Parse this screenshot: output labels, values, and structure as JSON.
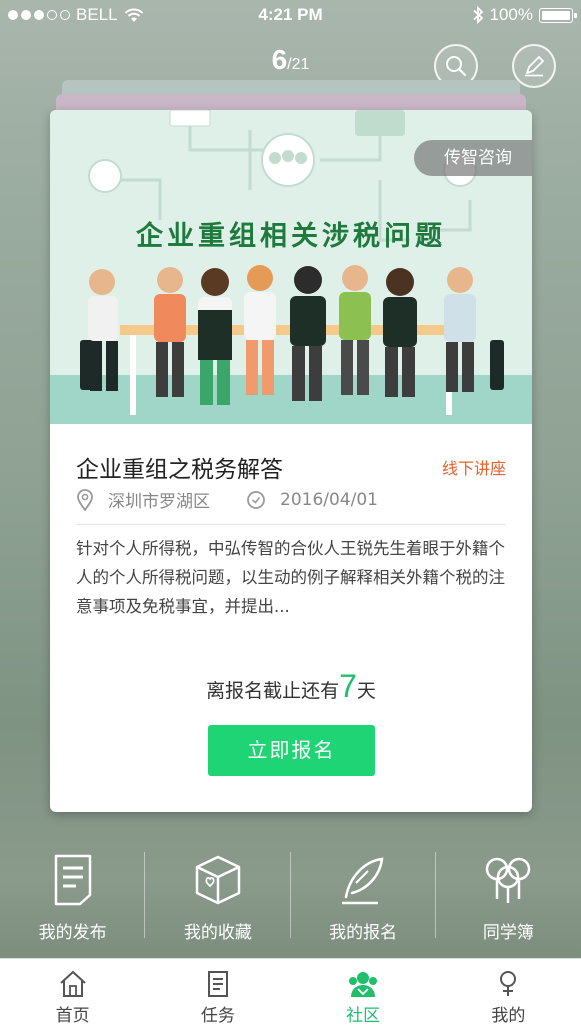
{
  "status": {
    "carrier": "BELL",
    "time": "4:21 PM",
    "battery": "100%"
  },
  "pager": {
    "current": "6",
    "total": "/21"
  },
  "card": {
    "tag": "传智咨询",
    "banner_title": "企业重组相关涉税问题",
    "title": "企业重组之税务解答",
    "type": "线下讲座",
    "location": "深圳市罗湖区",
    "date": "2016/04/01",
    "description": "针对个人所得税，中弘传智的合伙人王锐先生着眼于外籍个人的个人所得税问题，以生动的例子解释相关外籍个税的注意事项及免税事宜，并提出...",
    "deadline_prefix": "离报名截止还有",
    "deadline_days": "7",
    "deadline_suffix": "天",
    "signup_label": "立即报名"
  },
  "quick_actions": [
    {
      "label": "我的发布",
      "icon": "document-list-icon"
    },
    {
      "label": "我的收藏",
      "icon": "heart-box-icon"
    },
    {
      "label": "我的报名",
      "icon": "feather-pen-icon"
    },
    {
      "label": "同学簿",
      "icon": "classmates-icon"
    }
  ],
  "tabs": [
    {
      "label": "首页",
      "icon": "home-icon",
      "active": false
    },
    {
      "label": "任务",
      "icon": "task-icon",
      "active": false
    },
    {
      "label": "社区",
      "icon": "community-icon",
      "active": true
    },
    {
      "label": "我的",
      "icon": "profile-icon",
      "active": false
    }
  ],
  "colors": {
    "accent": "#1fd474",
    "type_tag": "#e8602a",
    "banner_title": "#1f7a3e"
  }
}
